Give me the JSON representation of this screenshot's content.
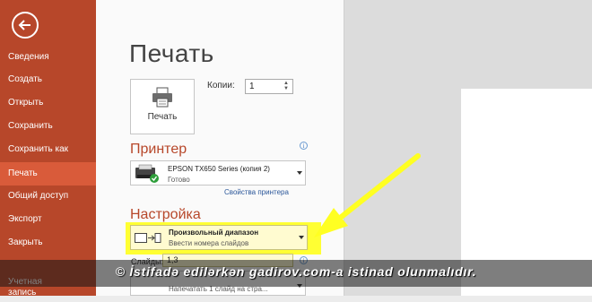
{
  "sidebar": {
    "items": [
      {
        "label": "Сведения"
      },
      {
        "label": "Создать"
      },
      {
        "label": "Открыть"
      },
      {
        "label": "Сохранить"
      },
      {
        "label": "Сохранить как"
      },
      {
        "label": "Печать",
        "active": true
      },
      {
        "label": "Общий доступ"
      },
      {
        "label": "Экспорт"
      },
      {
        "label": "Закрыть"
      },
      {
        "label": "Учетная запись"
      }
    ]
  },
  "main": {
    "title": "Печать",
    "print_button_label": "Печать",
    "copies_label": "Копии:",
    "copies_value": "1",
    "printer_section_title": "Принтер",
    "printer_name": "EPSON TX650 Series (копия 2)",
    "printer_status": "Готово",
    "printer_properties_link": "Свойства принтера",
    "settings_section_title": "Настройка",
    "range_title": "Произвольный диапазон",
    "range_subtitle": "Ввести номера слайдов",
    "slides_label": "Слайды:",
    "slides_value": "1,3",
    "layout_subtitle": "Напечатать 1 слайд на стра..."
  },
  "watermark": "© İstifadə edilərkən gadirov.com-a istinad olunmalıdır.",
  "colors": {
    "sidebar": "#b7472a",
    "sidebar_active": "#d95b3a",
    "section_title": "#b7472a",
    "highlight": "#ffff33",
    "link": "#2b579a"
  },
  "icons": [
    "back-arrow-icon",
    "printer-icon",
    "info-icon",
    "dropdown-arrow-icon",
    "range-icon",
    "yellow-arrow-annotation"
  ]
}
